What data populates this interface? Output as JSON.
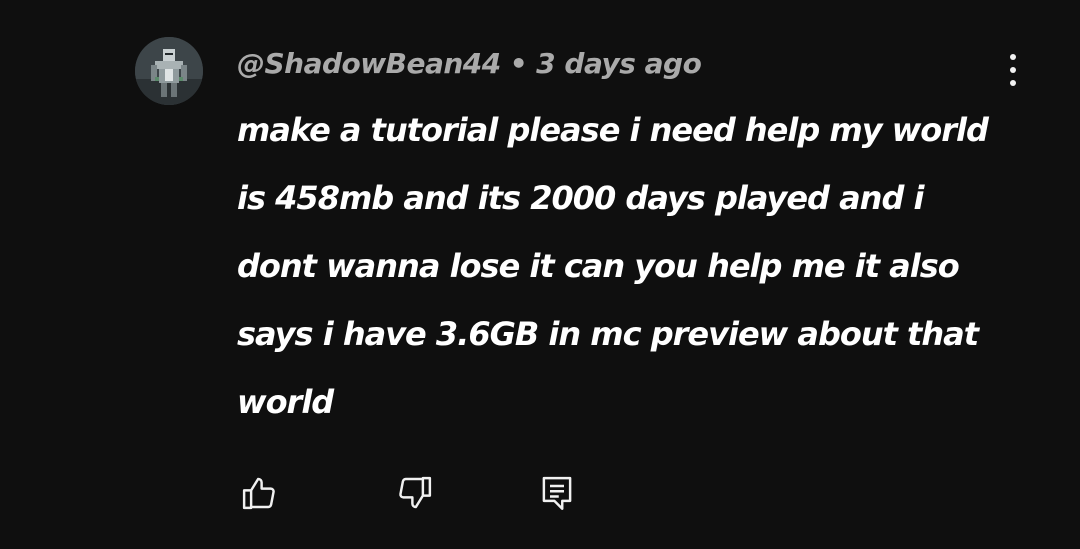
{
  "comment": {
    "author": "@ShadowBean44",
    "separator": "•",
    "timestamp": "3 days ago",
    "text": "make a tutorial please i need help my world is 458mb and its 2000 days played and i dont wanna lose it can you help me it also says i have 3.6GB in mc preview about that world",
    "avatar_icon": "armored-knight-avatar",
    "menu_icon": "more-vertical-icon",
    "actions": {
      "like_icon": "thumbs-up-icon",
      "dislike_icon": "thumbs-down-icon",
      "reply_icon": "reply-comment-icon"
    }
  },
  "colors": {
    "background": "#0f0f0f",
    "text_primary": "#ffffff",
    "text_secondary": "#aaaaaa"
  }
}
